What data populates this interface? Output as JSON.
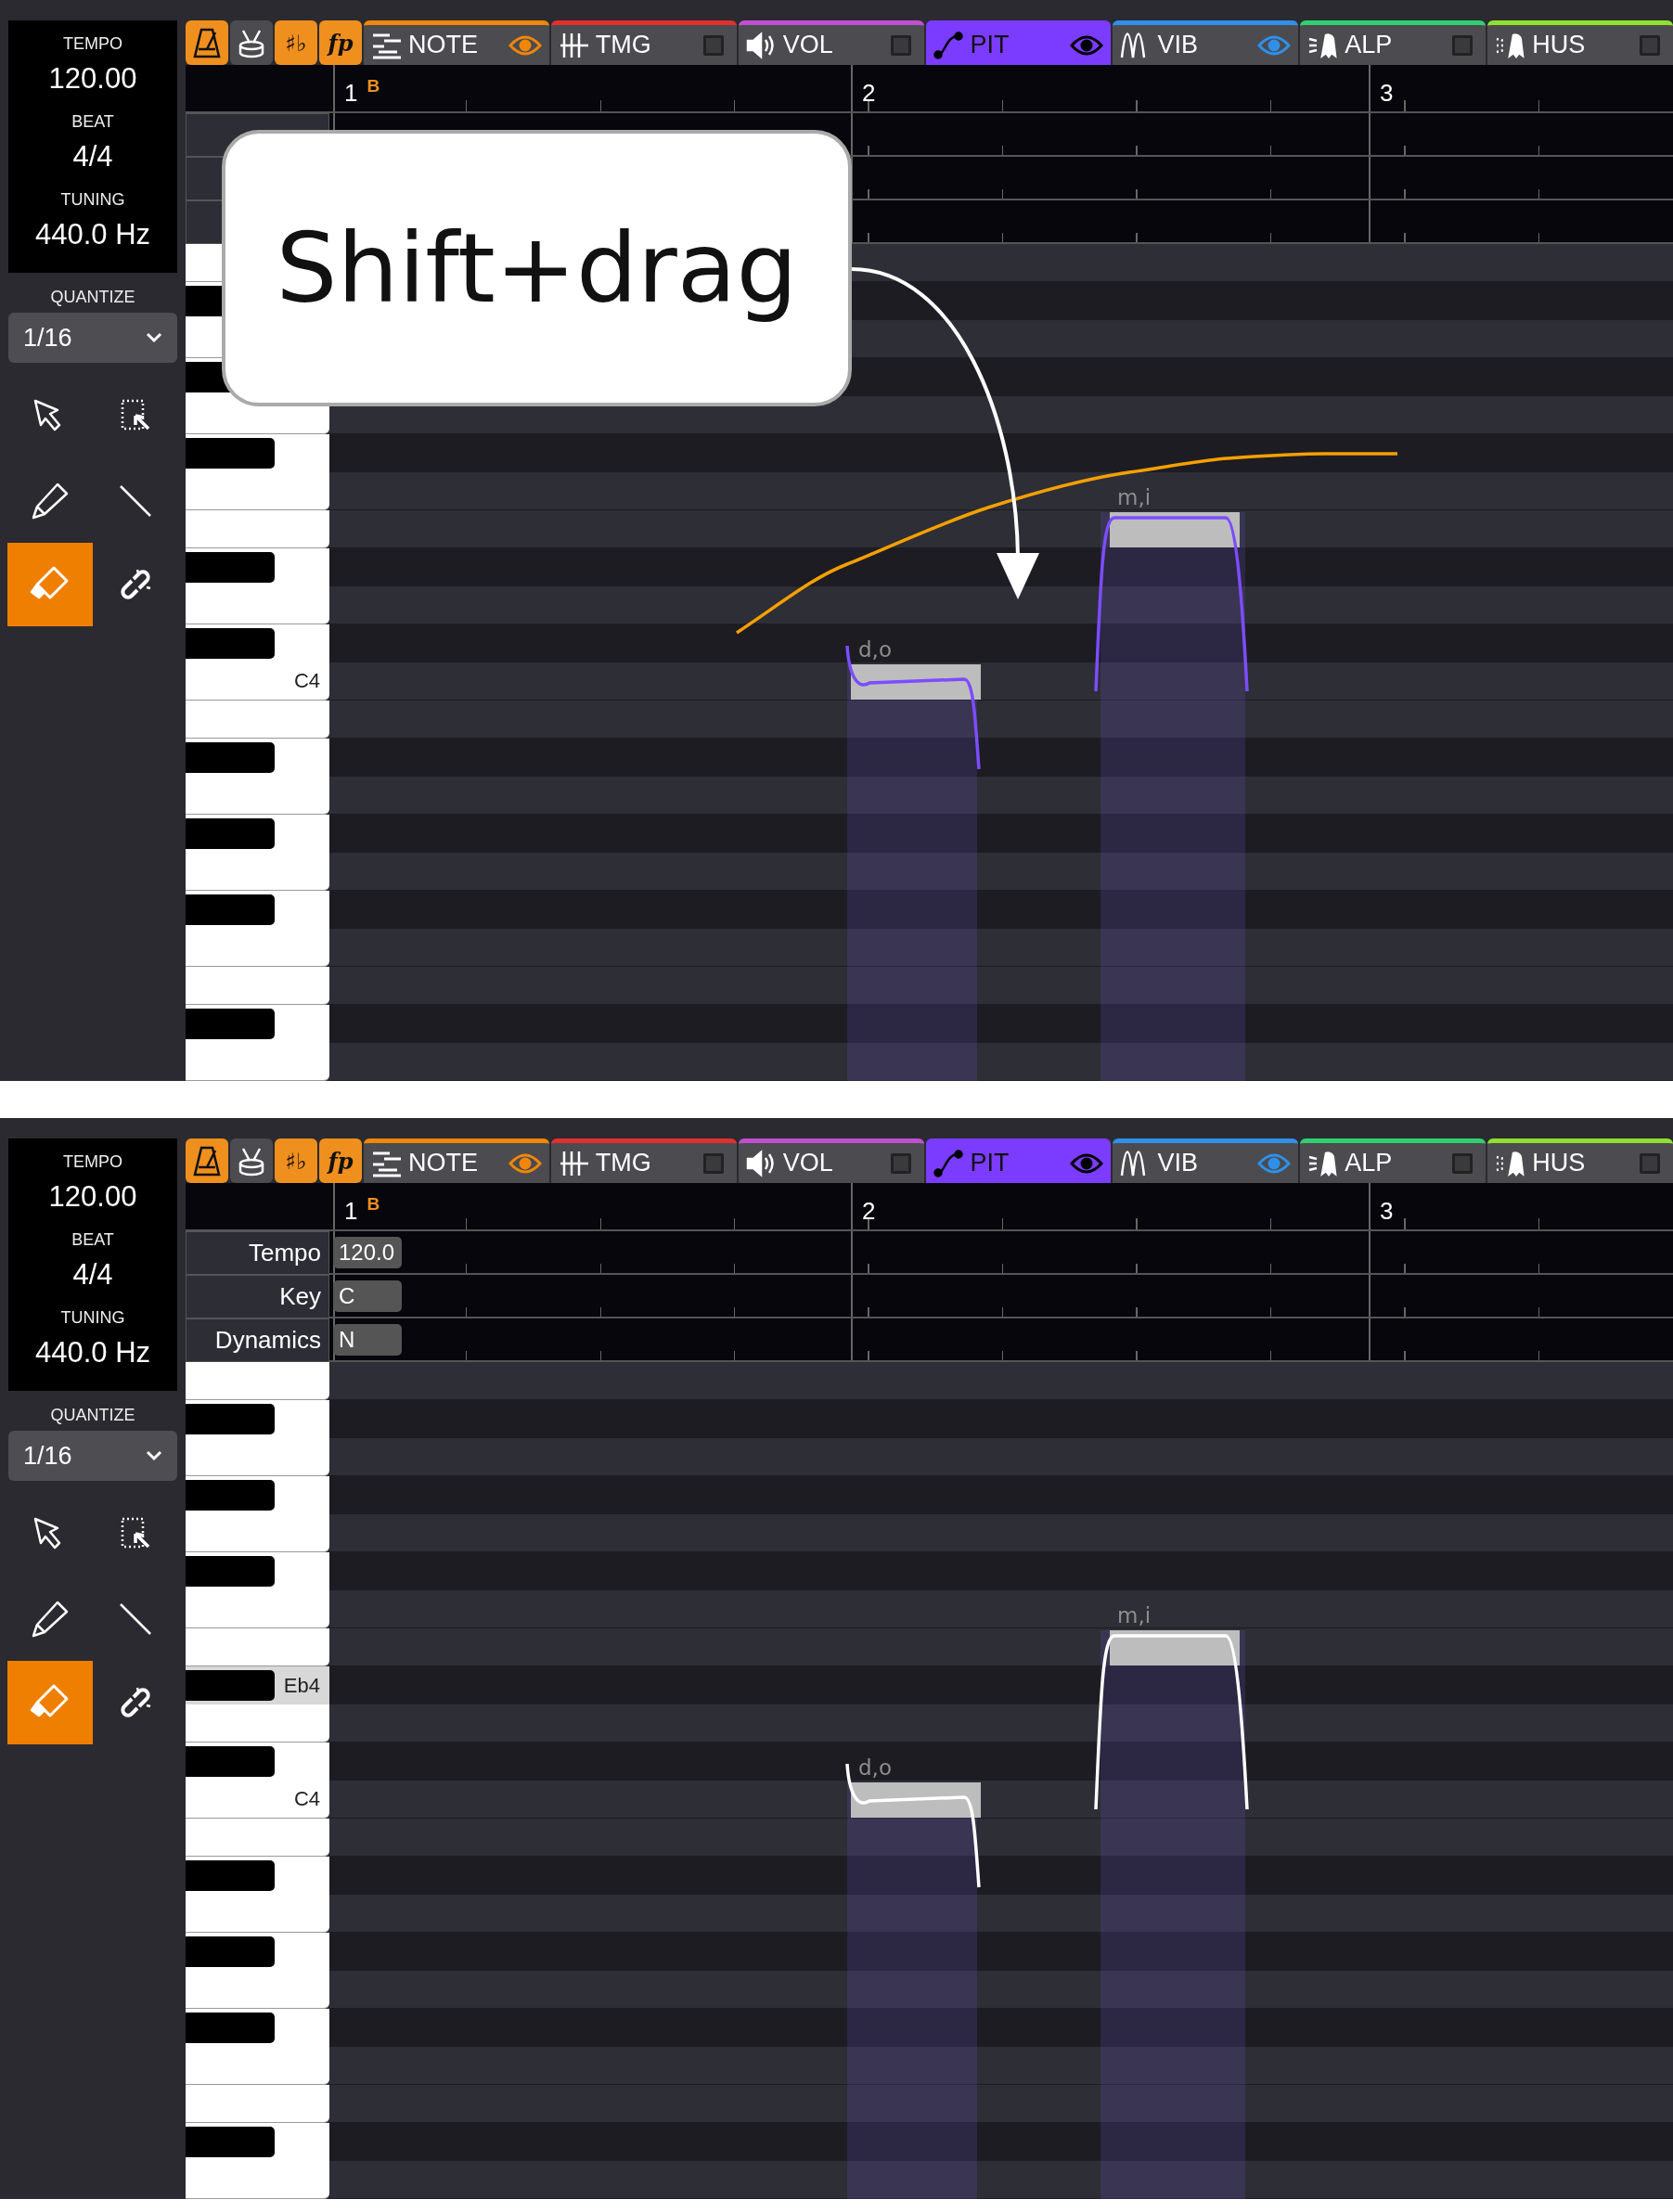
{
  "panels": [
    {
      "sidebar": {
        "tempo": {
          "label": "TEMPO",
          "value": "120.00"
        },
        "beat": {
          "label": "BEAT",
          "value": "4/4"
        },
        "tuning": {
          "label": "TUNING",
          "value": "440.0 Hz"
        },
        "quantize": {
          "label": "QUANTIZE",
          "value": "1/16"
        },
        "tools": [
          {
            "kind": "pointer",
            "selected": false
          },
          {
            "kind": "marquee",
            "selected": false
          },
          {
            "kind": "pencil",
            "selected": false
          },
          {
            "kind": "line",
            "selected": false
          },
          {
            "kind": "eraser",
            "selected": true
          },
          {
            "kind": "knife",
            "selected": false
          }
        ]
      },
      "toggles": [
        {
          "kind": "metronome",
          "on": true
        },
        {
          "kind": "drum",
          "on": false
        },
        {
          "kind": "text",
          "label": "♯♭",
          "on": true
        },
        {
          "kind": "text",
          "label": "fp",
          "on": true
        }
      ],
      "tabs": [
        {
          "kind": "note",
          "label": "NOTE",
          "color": "#f0860a",
          "selected": false,
          "shown": true
        },
        {
          "kind": "timing",
          "label": "TMG",
          "color": "#e03030",
          "selected": false,
          "shown": false
        },
        {
          "kind": "volume",
          "label": "VOL",
          "color": "#c050d0",
          "selected": false,
          "shown": false
        },
        {
          "kind": "pitch",
          "label": "PIT",
          "color": "#7c3cff",
          "selected": true,
          "shown": true
        },
        {
          "kind": "vibrato",
          "label": "VIB",
          "color": "#3090e8",
          "selected": false,
          "shown": true
        },
        {
          "kind": "alp",
          "label": "ALP",
          "color": "#30d070",
          "selected": false,
          "shown": false
        },
        {
          "kind": "hus",
          "label": "HUS",
          "color": "#90e030",
          "selected": false,
          "shown": false
        }
      ],
      "ruler": [
        {
          "bar": "1",
          "marker": "B"
        },
        {
          "bar": "2"
        },
        {
          "bar": "3"
        }
      ],
      "keys": [
        {
          "kind": "white",
          "highlighted": false
        },
        {
          "kind": "black",
          "highlighted": false
        },
        {
          "kind": "white",
          "highlighted": false
        },
        {
          "kind": "black",
          "highlighted": false
        },
        {
          "kind": "white",
          "highlighted": false
        },
        {
          "kind": "black",
          "highlighted": false
        },
        {
          "kind": "white",
          "highlighted": false
        },
        {
          "kind": "white",
          "highlighted": false
        },
        {
          "kind": "black",
          "highlighted": false
        },
        {
          "kind": "white",
          "highlighted": false
        },
        {
          "kind": "black",
          "highlighted": false
        },
        {
          "kind": "white",
          "label": "C4",
          "highlighted": false
        },
        {
          "kind": "white",
          "highlighted": false
        },
        {
          "kind": "black",
          "highlighted": false
        },
        {
          "kind": "white",
          "highlighted": false
        },
        {
          "kind": "black",
          "highlighted": false
        },
        {
          "kind": "white",
          "highlighted": false
        },
        {
          "kind": "black",
          "highlighted": false
        },
        {
          "kind": "white",
          "highlighted": false
        },
        {
          "kind": "white",
          "highlighted": false
        },
        {
          "kind": "black",
          "highlighted": false
        },
        {
          "kind": "white",
          "highlighted": false
        }
      ],
      "notes": [
        {
          "lyric": "d,o"
        },
        {
          "lyric": "m,i"
        }
      ],
      "pitch_curve": {
        "kind": "default"
      },
      "pencil_stroke": true,
      "callout": {
        "text": "Shift+drag"
      }
    },
    {
      "sidebar": {
        "tempo": {
          "label": "TEMPO",
          "value": "120.00"
        },
        "beat": {
          "label": "BEAT",
          "value": "4/4"
        },
        "tuning": {
          "label": "TUNING",
          "value": "440.0 Hz"
        },
        "quantize": {
          "label": "QUANTIZE",
          "value": "1/16"
        },
        "tools": [
          {
            "kind": "pointer",
            "selected": false
          },
          {
            "kind": "marquee",
            "selected": false
          },
          {
            "kind": "pencil",
            "selected": false
          },
          {
            "kind": "line",
            "selected": false
          },
          {
            "kind": "eraser",
            "selected": true
          },
          {
            "kind": "knife",
            "selected": false
          }
        ]
      },
      "toggles": [
        {
          "kind": "metronome",
          "on": true
        },
        {
          "kind": "drum",
          "on": false
        },
        {
          "kind": "text",
          "label": "♯♭",
          "on": true
        },
        {
          "kind": "text",
          "label": "fp",
          "on": true
        }
      ],
      "tabs": [
        {
          "kind": "note",
          "label": "NOTE",
          "color": "#f0860a",
          "selected": false,
          "shown": true
        },
        {
          "kind": "timing",
          "label": "TMG",
          "color": "#e03030",
          "selected": false,
          "shown": false
        },
        {
          "kind": "volume",
          "label": "VOL",
          "color": "#c050d0",
          "selected": false,
          "shown": false
        },
        {
          "kind": "pitch",
          "label": "PIT",
          "color": "#7c3cff",
          "selected": true,
          "shown": true
        },
        {
          "kind": "vibrato",
          "label": "VIB",
          "color": "#3090e8",
          "selected": false,
          "shown": true
        },
        {
          "kind": "alp",
          "label": "ALP",
          "color": "#30d070",
          "selected": false,
          "shown": false
        },
        {
          "kind": "hus",
          "label": "HUS",
          "color": "#90e030",
          "selected": false,
          "shown": false
        }
      ],
      "ruler": [
        {
          "bar": "1",
          "marker": "B"
        },
        {
          "bar": "2"
        },
        {
          "bar": "3"
        }
      ],
      "expression_rows": [
        {
          "label": "Tempo",
          "value": "120.0"
        },
        {
          "label": "Key",
          "value": "C"
        },
        {
          "label": "Dynamics",
          "value": "N"
        }
      ],
      "keys": [
        {
          "kind": "white",
          "highlighted": false
        },
        {
          "kind": "black",
          "highlighted": false
        },
        {
          "kind": "white",
          "highlighted": false
        },
        {
          "kind": "black",
          "highlighted": false
        },
        {
          "kind": "white",
          "highlighted": false
        },
        {
          "kind": "black",
          "highlighted": false
        },
        {
          "kind": "white",
          "highlighted": false
        },
        {
          "kind": "white",
          "highlighted": false
        },
        {
          "kind": "black",
          "label": "Eb4",
          "highlighted": true
        },
        {
          "kind": "white",
          "highlighted": false
        },
        {
          "kind": "black",
          "highlighted": false
        },
        {
          "kind": "white",
          "label": "C4",
          "highlighted": false
        },
        {
          "kind": "white",
          "highlighted": false
        },
        {
          "kind": "black",
          "highlighted": false
        },
        {
          "kind": "white",
          "highlighted": false
        },
        {
          "kind": "black",
          "highlighted": false
        },
        {
          "kind": "white",
          "highlighted": false
        },
        {
          "kind": "black",
          "highlighted": false
        },
        {
          "kind": "white",
          "highlighted": false
        },
        {
          "kind": "white",
          "highlighted": false
        },
        {
          "kind": "black",
          "highlighted": false
        },
        {
          "kind": "white",
          "highlighted": false
        }
      ],
      "notes": [
        {
          "lyric": "d,o"
        },
        {
          "lyric": "m,i"
        }
      ],
      "pitch_curve": {
        "kind": "edited"
      },
      "pencil_stroke": false
    }
  ]
}
